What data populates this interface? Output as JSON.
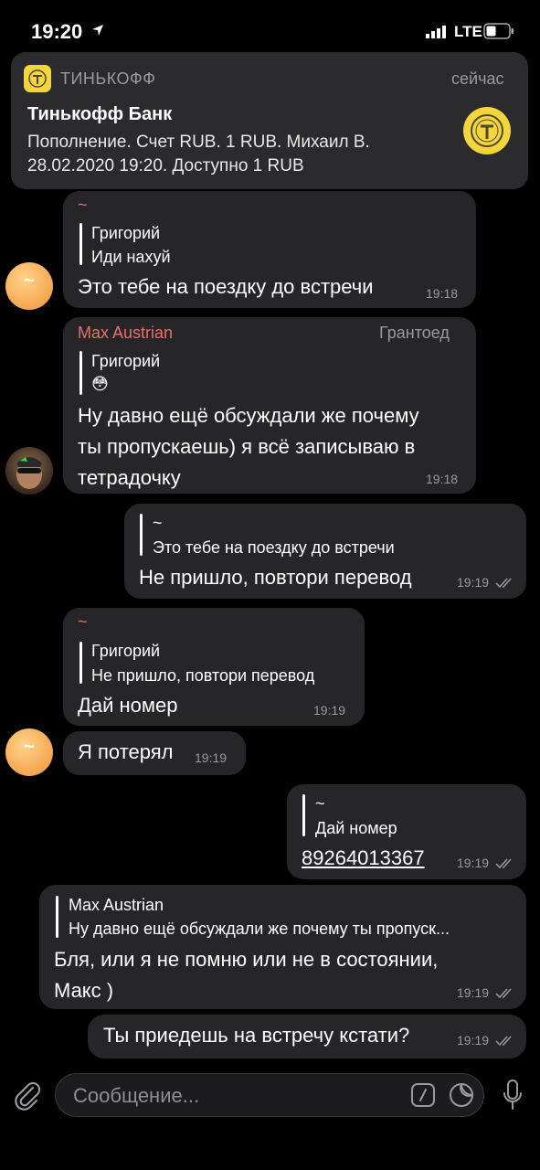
{
  "status_bar": {
    "time": "19:20",
    "network": "LTE"
  },
  "notification": {
    "app_name": "ТИНЬКОФФ",
    "time": "сейчас",
    "title": "Тинькофф Банк",
    "body_line1": "Пополнение. Счет RUB. 1 RUB. Михаил В.",
    "body_line2": "28.02.2020 19:20. Доступно 1 RUB"
  },
  "messages": [
    {
      "sender": "~",
      "quote_name": "Григорий",
      "quote_text": "Иди нахуй",
      "text": "Это тебе на поездку до встречи",
      "time": "19:18"
    },
    {
      "sender": "Max Austrian",
      "badge": "Грантоед",
      "quote_name": "Григорий",
      "quote_text": "😳",
      "text_line1": "Ну давно ещё обсуждали же почему",
      "text_line2": "ты пропускаешь) я всё записываю в",
      "text_line3": "тетрадочку",
      "time": "19:18"
    },
    {
      "quote_name": "~",
      "quote_text": "Это тебе на поездку до встречи",
      "text": "Не пришло, повтори перевод",
      "time": "19:19"
    },
    {
      "sender": "~",
      "quote_name": "Григорий",
      "quote_text": "Не пришло, повтори перевод",
      "text": "Дай номер",
      "time": "19:19"
    },
    {
      "text": "Я потерял",
      "time": "19:19"
    },
    {
      "quote_name": "~",
      "quote_text": "Дай номер",
      "text": "89264013367",
      "time": "19:19"
    },
    {
      "quote_name": "Max Austrian",
      "quote_text": "Ну давно ещё обсуждали же почему ты пропуск...",
      "text_line1": "Бля, или я не помню или не в состоянии,",
      "text_line2": "Макс )",
      "time": "19:19"
    },
    {
      "text": "Ты приедешь на встречу кстати?",
      "time": "19:19"
    }
  ],
  "avatars": {
    "tilde_initial": "~"
  },
  "input": {
    "placeholder": "Сообщение..."
  },
  "colors": {
    "background": "#000000",
    "bubble": "#262628",
    "sender_name": "#e8706a",
    "muted": "#9a9a9e",
    "brand_yellow": "#f5d53c"
  },
  "icons": [
    "location-arrow-icon",
    "signal-icon",
    "battery-icon",
    "tinkoff-logo-icon",
    "double-check-icon",
    "paperclip-icon",
    "bot-command-icon",
    "sticker-icon",
    "microphone-icon"
  ]
}
